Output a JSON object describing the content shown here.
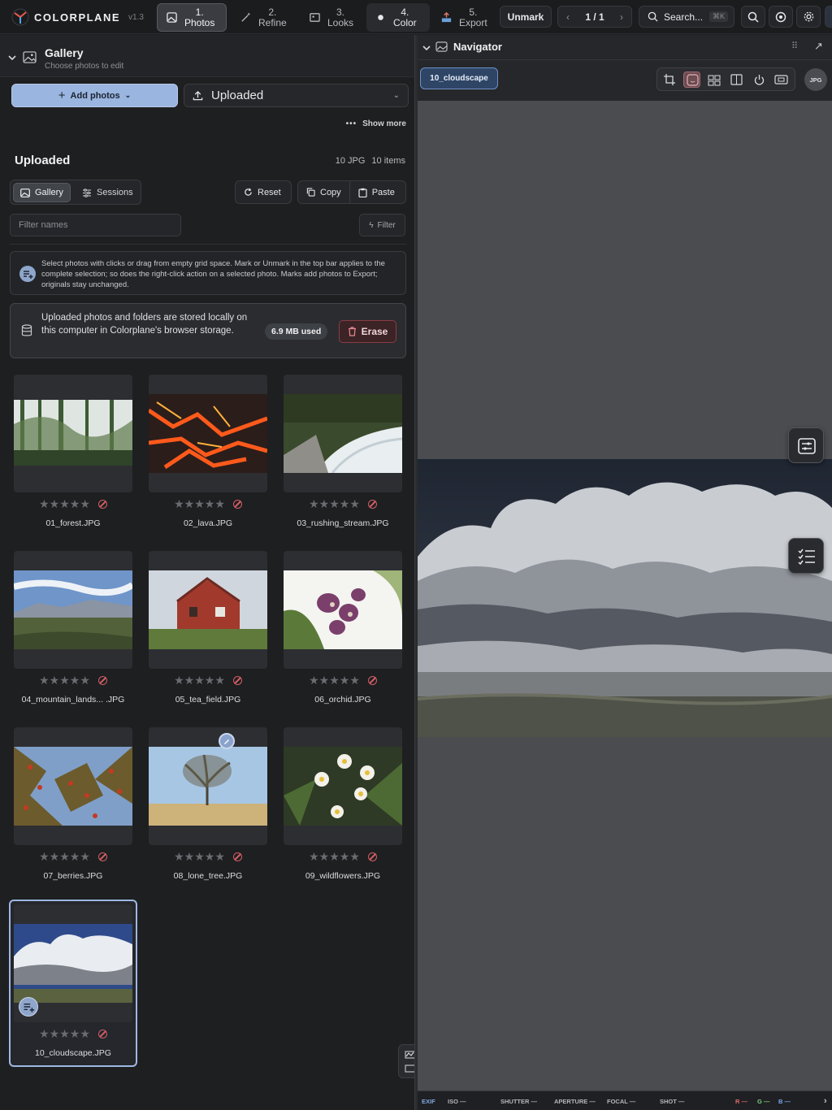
{
  "app": {
    "name": "COLORPLANE",
    "version": "v1.3"
  },
  "steps": [
    {
      "num": "1.",
      "label": "Photos"
    },
    {
      "num": "2.",
      "label": "Refine"
    },
    {
      "num": "3.",
      "label": "Looks"
    },
    {
      "num": "4.",
      "label": "Color"
    },
    {
      "num": "5.",
      "label": "Export"
    }
  ],
  "topbar": {
    "unmark": "Unmark",
    "pager": "1 / 1",
    "search_placeholder": "Search...",
    "search_kbd": "⌘K"
  },
  "gallery": {
    "title": "Gallery",
    "subtitle": "Choose photos to edit",
    "add_photos": "Add photos",
    "source": "Uploaded",
    "show_more": "Show more",
    "section": "Uploaded",
    "count_type": "10 JPG",
    "count_items": "10 items",
    "tab_gallery": "Gallery",
    "tab_sessions": "Sessions",
    "reset": "Reset",
    "copy": "Copy",
    "paste": "Paste",
    "filter_placeholder": "Filter names",
    "filter_btn": "Filter",
    "info": "Select photos with clicks or drag from empty grid space. Mark or Unmark in the top bar applies to the complete selection; so does the right-click action on a selected photo. Marks add photos to Export; originals stay unchanged.",
    "storage": "Uploaded photos and folders are stored locally on this computer in Colorplane's browser storage.",
    "used": "6.9 MB used",
    "erase": "Erase",
    "photos": [
      "01_forest.JPG",
      "02_lava.JPG",
      "03_rushing_stream.JPG",
      "04_mountain_lands... .JPG",
      "05_tea_field.JPG",
      "06_orchid.JPG",
      "07_berries.JPG",
      "08_lone_tree.JPG",
      "09_wildflowers.JPG",
      "10_cloudscape.JPG"
    ]
  },
  "navigator": {
    "title": "Navigator",
    "chip": "10_cloudscape",
    "format": "JPG"
  },
  "exif": {
    "label": "EXIF",
    "iso": "ISO —",
    "shutter": "SHUTTER —",
    "aperture": "APERTURE —",
    "focal": "FOCAL —",
    "shot": "SHOT —",
    "r": "R —",
    "g": "G —",
    "b": "B —"
  },
  "colors": {
    "accent": "#9ab5df",
    "danger": "#d45e66"
  }
}
